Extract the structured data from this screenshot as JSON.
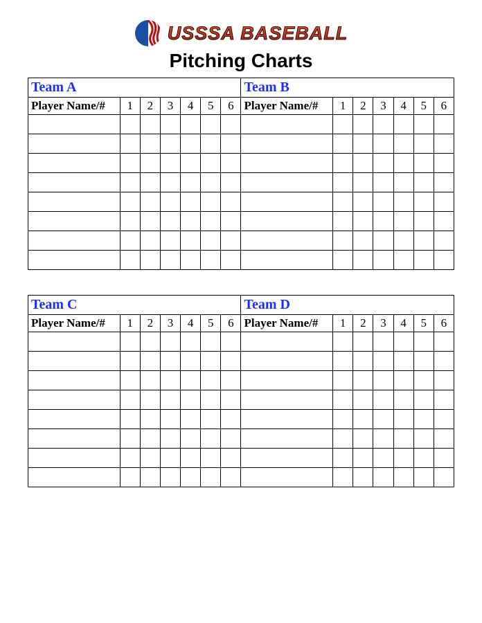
{
  "logo_text": "USSSA BASEBALL",
  "title": "Pitching Charts",
  "player_label": "Player Name/#",
  "columns": [
    "1",
    "2",
    "3",
    "4",
    "5",
    "6"
  ],
  "row_count": 8,
  "pairs": [
    {
      "left": "Team A",
      "right": "Team B"
    },
    {
      "left": "Team C",
      "right": "Team D"
    }
  ]
}
